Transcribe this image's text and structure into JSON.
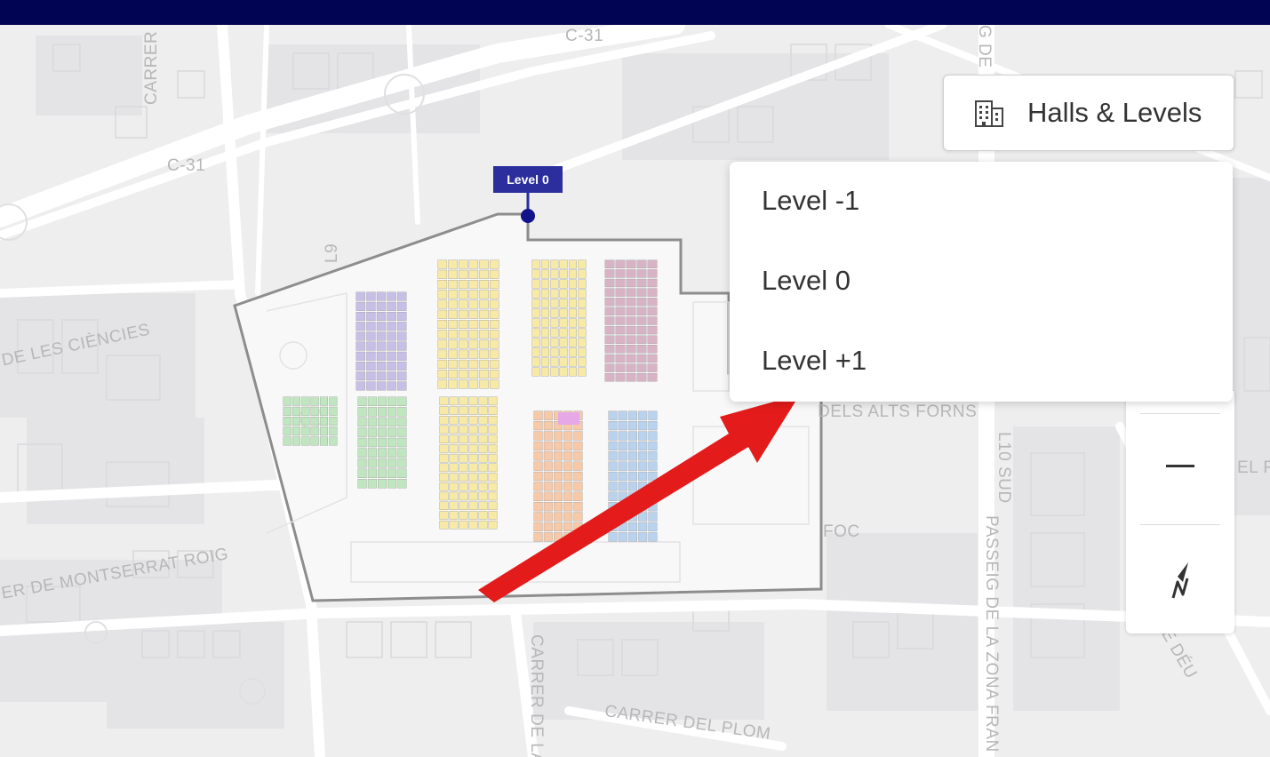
{
  "top_bar": {
    "color": "#010452"
  },
  "map": {
    "road_labels": {
      "c31_top": "C-31",
      "c31_left": "C-31",
      "carrer_top": "CARRER",
      "de_les_ciencies": "DE LES CIÈNCIES",
      "l9": "L9",
      "montserrat_roig": "ER DE MONTSERRAT ROIG",
      "dels_alts_forns": "DELS ALTS FORNS",
      "l10_sud": "L10 SUD",
      "passeig": "PASSEIG DE LA ZONA FRAN",
      "carrer_de_la": "CARRER DE LA",
      "carrer_del_plom": "CARRER DEL PLOM",
      "foc": "FOC",
      "el_fo": "EL FO",
      "mare_de_deu": "MARE DE DÉU",
      "g_de": "G DE"
    },
    "venue_marker": {
      "label": "Level 0",
      "color": "#2b2e9c"
    },
    "hall_colors": {
      "purple": "#c7bfe6",
      "green": "#bfe6bf",
      "yellow": "#f7e9a6",
      "orange": "#f7c9a8",
      "blue": "#b9d3ef",
      "mauve": "#d8b3c6",
      "pink": "#e6a8e6"
    }
  },
  "halls_levels_button": {
    "label": "Halls & Levels",
    "icon": "building-icon"
  },
  "levels_dropdown": {
    "items": [
      {
        "label": "Level -1"
      },
      {
        "label": "Level 0"
      },
      {
        "label": "Level +1"
      }
    ]
  },
  "map_controls": {
    "zoom_out_icon": "minus-icon",
    "compass_icon": "north-arrow-icon"
  },
  "annotation_arrow": {
    "color": "#e31b1b"
  }
}
